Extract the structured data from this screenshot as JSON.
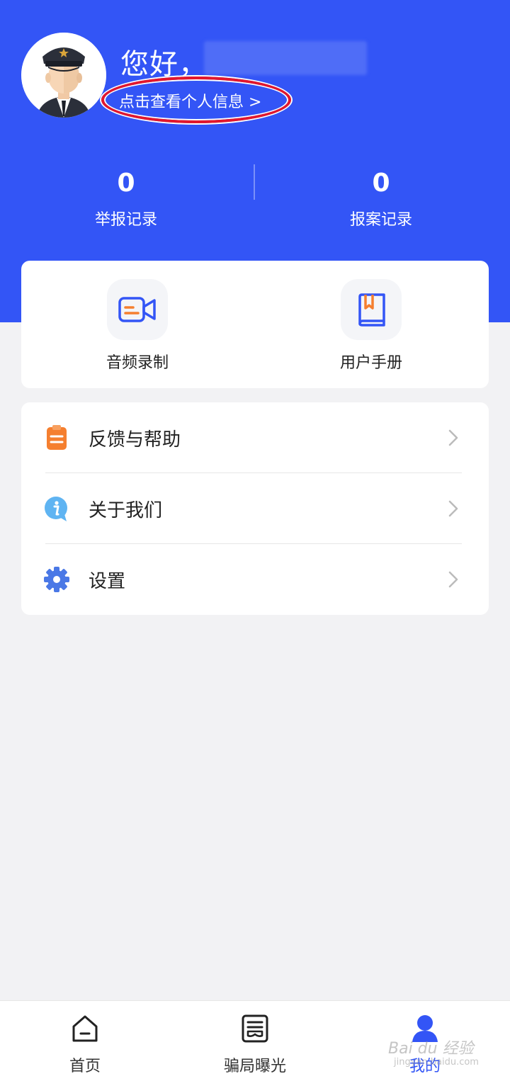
{
  "colors": {
    "brand": "#3355f6",
    "page_bg": "#f2f2f4",
    "highlight": "#e3172d",
    "orange": "#f57f2f"
  },
  "profile": {
    "greeting": "您好，",
    "view_info_link": "点击查看个人信息 >",
    "avatar_icon": "police-officer-avatar"
  },
  "stats": [
    {
      "value": "0",
      "label": "举报记录"
    },
    {
      "value": "0",
      "label": "报案记录"
    }
  ],
  "quick_actions": [
    {
      "label": "音频录制",
      "icon": "video-record-icon"
    },
    {
      "label": "用户手册",
      "icon": "manual-book-icon"
    }
  ],
  "menu": [
    {
      "label": "反馈与帮助",
      "icon": "clipboard-icon"
    },
    {
      "label": "关于我们",
      "icon": "info-icon"
    },
    {
      "label": "设置",
      "icon": "gear-icon"
    }
  ],
  "tabs": [
    {
      "label": "首页",
      "icon": "home-icon"
    },
    {
      "label": "骗局曝光",
      "icon": "exposure-icon"
    },
    {
      "label": "我的",
      "icon": "user-icon",
      "active": true
    }
  ],
  "watermark": {
    "text": "Bai du 经验",
    "url": "jingyan.baidu.com"
  }
}
